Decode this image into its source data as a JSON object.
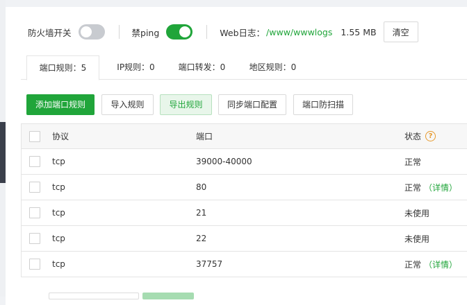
{
  "status_bar": {
    "firewall_label": "防火墙开关",
    "firewall_on": false,
    "ping_label": "禁ping",
    "ping_on": true,
    "weblog_label": "Web日志：",
    "weblog_path": "/www/wwwlogs",
    "weblog_size": "1.55 MB",
    "clear_label": "清空"
  },
  "tabs": [
    {
      "label": "端口规则：5",
      "active": true
    },
    {
      "label": "IP规则：0",
      "active": false
    },
    {
      "label": "端口转发：0",
      "active": false
    },
    {
      "label": "地区规则：0",
      "active": false
    }
  ],
  "actions": {
    "add": "添加端口规则",
    "import": "导入规则",
    "export": "导出规则",
    "sync": "同步端口配置",
    "scan": "端口防扫描"
  },
  "table": {
    "columns": {
      "protocol": "协议",
      "port": "端口",
      "status": "状态"
    },
    "rows": [
      {
        "protocol": "tcp",
        "port": "39000-40000",
        "status": "正常",
        "detail": ""
      },
      {
        "protocol": "tcp",
        "port": "80",
        "status": "正常",
        "detail": "（详情）"
      },
      {
        "protocol": "tcp",
        "port": "21",
        "status": "未使用",
        "detail": ""
      },
      {
        "protocol": "tcp",
        "port": "22",
        "status": "未使用",
        "detail": ""
      },
      {
        "protocol": "tcp",
        "port": "37757",
        "status": "正常",
        "detail": "（详情）"
      }
    ]
  },
  "colors": {
    "accent": "#20a53a",
    "help": "#e6992c"
  }
}
